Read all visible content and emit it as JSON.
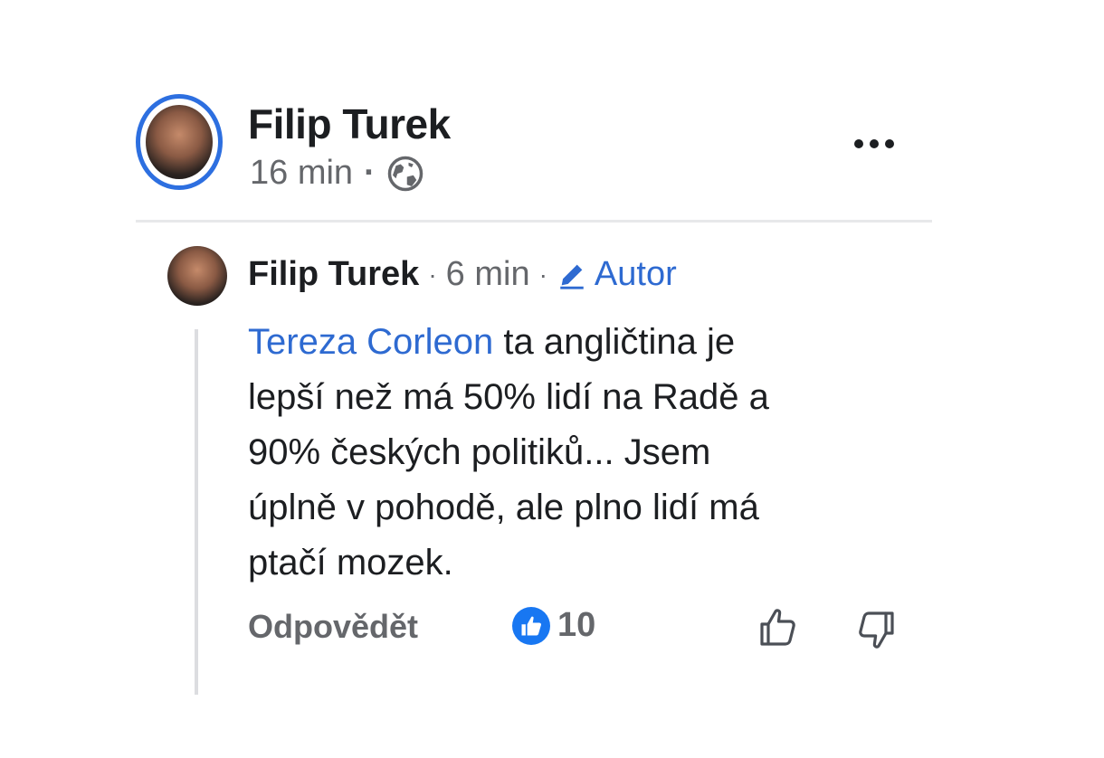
{
  "post": {
    "author": "Filip Turek",
    "time": "16 min",
    "separator": "·",
    "privacy_icon": "globe-icon"
  },
  "comment": {
    "author": "Filip Turek",
    "separator": "·",
    "time": "6 min",
    "badge": "Autor",
    "mention": "Tereza Corleon",
    "text_lines": [
      " ta angličtina je",
      "lepší než má 50% lidí na Radě a",
      "90% českých politiků... Jsem",
      "úplně v pohodě, ale plno lidí má",
      "ptačí mozek."
    ],
    "actions": {
      "reply_label": "Odpovědět",
      "like_count": "10"
    }
  },
  "colors": {
    "accent_blue": "#2e6ad1",
    "meta_gray": "#65676b",
    "text": "#1c1e21",
    "avatar_ring": "#2d6fe0"
  },
  "icons": [
    "globe-icon",
    "more-options-icon",
    "pencil-icon",
    "like-reaction-icon",
    "thumbs-up-icon",
    "thumbs-down-icon"
  ]
}
